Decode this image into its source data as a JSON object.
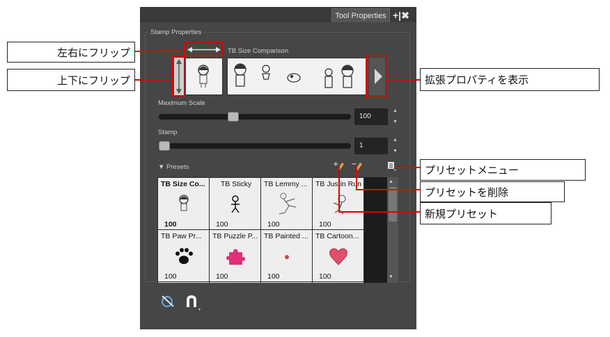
{
  "panel": {
    "tab_title": "Tool Properties",
    "tab_icons": "+|✖",
    "group_title": "Stamp Properties",
    "size_comparison_label": "TB Size Comparison",
    "max_scale": {
      "label": "Maximum Scale",
      "value": "100",
      "level_fraction": 0.38
    },
    "stamp": {
      "label": "Stamp",
      "value": "1",
      "level_fraction": 0.0
    },
    "presets_label": "Presets",
    "presets": [
      {
        "name": "TB Size Co...",
        "value": "100",
        "icon": "girl-figure-icon",
        "selected": true
      },
      {
        "name": "TB Sticky",
        "value": "100",
        "icon": "stick-figure-icon"
      },
      {
        "name": "TB Lemmy ...",
        "value": "100",
        "icon": "running-figure-icon"
      },
      {
        "name": "TB Justin Run",
        "value": "100",
        "icon": "creature-figure-icon"
      },
      {
        "name": "TB Paw Pr...",
        "value": "100",
        "icon": "paw-print-icon"
      },
      {
        "name": "TB Puzzle P...",
        "value": "100",
        "icon": "puzzle-piece-icon"
      },
      {
        "name": "TB Painted ...",
        "value": "100",
        "icon": "small-dot-icon"
      },
      {
        "name": "TB Cartoon...",
        "value": "100",
        "icon": "heart-icon"
      }
    ],
    "colors": {
      "selection": "#3c63e0",
      "paw": "#111111",
      "puzzle": "#e0307a",
      "dot": "#c84a4a",
      "heart": "#e0506a"
    }
  },
  "callouts": {
    "flip_horizontal": "左右にフリップ",
    "flip_vertical": "上下にフリップ",
    "show_extended": "拡張プロパティを表示",
    "preset_menu": "プリセットメニュー",
    "delete_preset": "プリセットを削除",
    "new_preset": "新規プリセット"
  }
}
